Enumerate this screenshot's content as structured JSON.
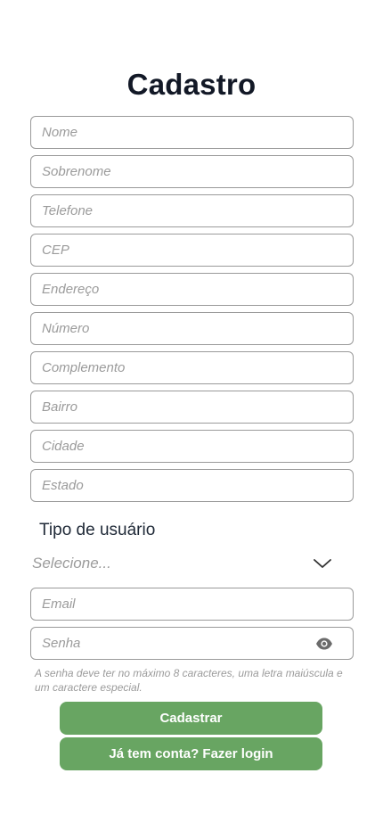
{
  "header": {
    "title": "Cadastro"
  },
  "form": {
    "fields": [
      {
        "placeholder": "Nome",
        "value": ""
      },
      {
        "placeholder": "Sobrenome",
        "value": ""
      },
      {
        "placeholder": "Telefone",
        "value": ""
      },
      {
        "placeholder": "CEP",
        "value": ""
      },
      {
        "placeholder": "Endereço",
        "value": ""
      },
      {
        "placeholder": "Número",
        "value": ""
      },
      {
        "placeholder": "Complemento",
        "value": ""
      },
      {
        "placeholder": "Bairro",
        "value": ""
      },
      {
        "placeholder": "Cidade",
        "value": ""
      },
      {
        "placeholder": "Estado",
        "value": ""
      }
    ],
    "user_type": {
      "label": "Tipo de usuário",
      "selected": "Selecione...",
      "icon": "chevron-down-icon"
    },
    "email": {
      "placeholder": "Email",
      "value": ""
    },
    "password": {
      "placeholder": "Senha",
      "value": "",
      "icon": "eye-icon"
    },
    "password_hint": "A senha deve ter no máximo 8 caracteres, uma letra maiúscula e um caractere especial."
  },
  "actions": {
    "submit_label": "Cadastrar",
    "login_label": "Já tem conta? Fazer login"
  },
  "colors": {
    "button": "#68a562",
    "border": "#9a9a9a",
    "placeholder": "#9b9b9b",
    "title": "#121826"
  }
}
